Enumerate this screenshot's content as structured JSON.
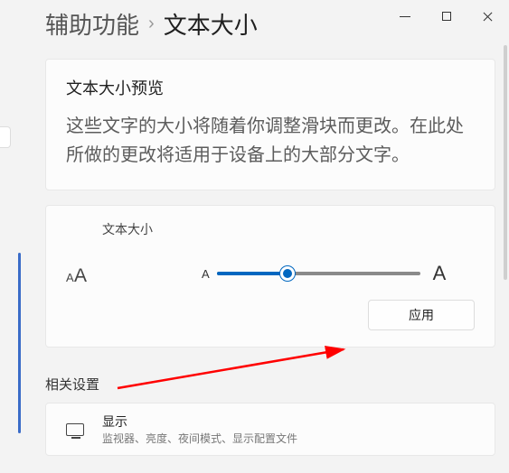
{
  "breadcrumb": {
    "parent": "辅助功能",
    "separator": "›",
    "current": "文本大小"
  },
  "preview": {
    "heading": "文本大小预览",
    "text": "这些文字的大小将随着你调整滑块而更改。在此处所做的更改将适用于设备上的大部分文字。"
  },
  "slider": {
    "label": "文本大小",
    "small_letter": "A",
    "big_letter": "A",
    "value_percent": 35,
    "apply_label": "应用"
  },
  "related": {
    "heading": "相关设置",
    "item": {
      "title": "显示",
      "subtitle": "监视器、亮度、夜间模式、显示配置文件"
    }
  }
}
